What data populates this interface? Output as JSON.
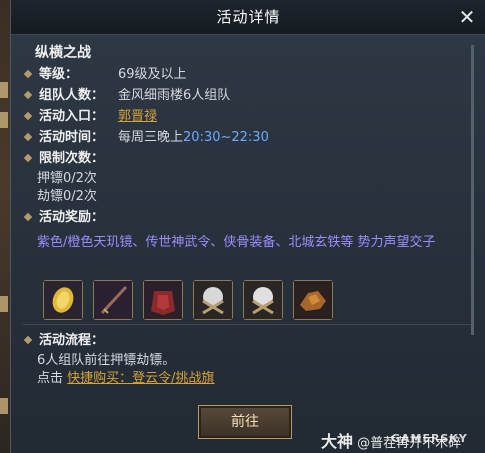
{
  "window": {
    "title": "活动详情"
  },
  "activity": {
    "name": "纵横之战",
    "level_label": "等级：",
    "level_value": "69级及以上",
    "team_label": "组队人数：",
    "team_value": "金风细雨楼6人组队",
    "entry_label": "活动入口：",
    "entry_value": "郭晋禄",
    "time_label": "活动时间：",
    "time_prefix": "每周三晚上",
    "time_value": "20:30~22:30",
    "limit_label": "限制次数：",
    "limit_escort": "押镖0/2次",
    "limit_rob": "劫镖0/2次",
    "reward_label": "活动奖励：",
    "reward_text": "紫色/橙色天玑镜、传世神武令、侠骨装备、北城玄铁等 势力声望交子",
    "reward_items": [
      {
        "icon": "gold-coin-icon"
      },
      {
        "icon": "sword-icon"
      },
      {
        "icon": "armor-icon"
      },
      {
        "icon": "white-orb-crossed-icon"
      },
      {
        "icon": "white-orb-crossed-icon"
      },
      {
        "icon": "ore-icon"
      }
    ],
    "flow_label": "活动流程：",
    "flow_line1": "6人组队前往押镖劫镖。",
    "flow_click": "点击",
    "flow_link": "快捷购买：登云令/挑战旗"
  },
  "buttons": {
    "go": "前往"
  },
  "watermark": {
    "text": "大神",
    "handle": "@普茬苒开不木碎",
    "brand": "GAMERSKY"
  },
  "colors": {
    "accent_gold": "#d8a23a",
    "time_blue": "#6ea8ff",
    "reward_purple": "#9d8cff"
  }
}
